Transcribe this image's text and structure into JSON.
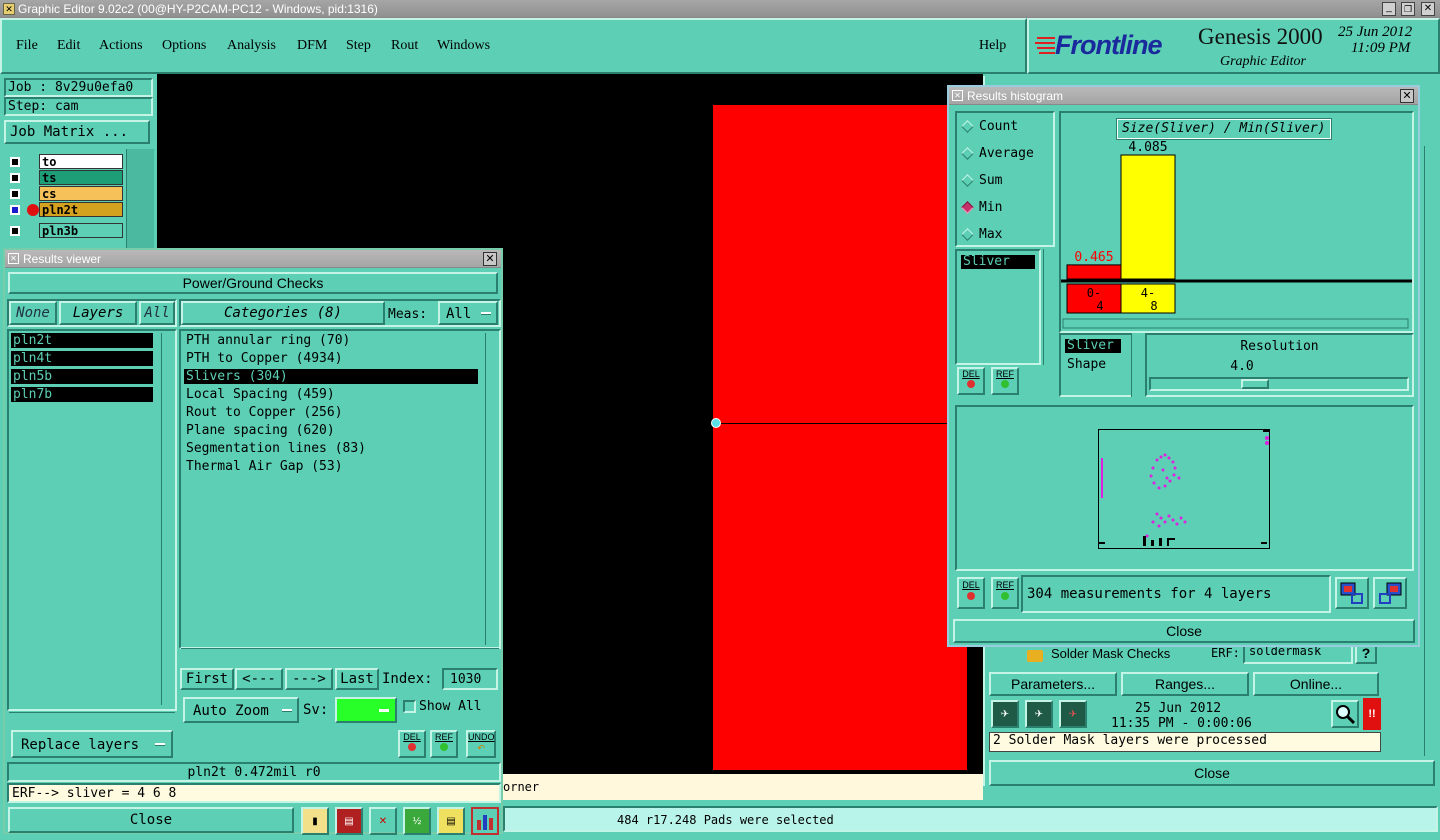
{
  "os_title": "Graphic Editor 9.02c2 (00@HY-P2CAM-PC12 - Windows, pid:1316)",
  "menu": [
    "File",
    "Edit",
    "Actions",
    "Options",
    "Analysis",
    "DFM",
    "Step",
    "Rout",
    "Windows"
  ],
  "help": "Help",
  "brand": {
    "logo": "Frontline",
    "product": "Genesis 2000",
    "subtitle": "Graphic Editor",
    "date": "25 Jun 2012",
    "time": "11:09 PM"
  },
  "job": {
    "job": "Job : 8v29u0efa0",
    "step": "Step: cam",
    "matrix_button": "Job Matrix ..."
  },
  "layers_panel": [
    {
      "name": "to",
      "color": "#ffffff"
    },
    {
      "name": "ts",
      "color": "#1e9e76"
    },
    {
      "name": "cs",
      "color": "#f7c15a"
    },
    {
      "name": "pln2t",
      "color": "#d4a21e"
    },
    {
      "name": "pln3b",
      "color": "#5ccfb4"
    }
  ],
  "results_viewer": {
    "title": "Results viewer",
    "header": "Power/Ground Checks",
    "none": "None",
    "layers": "Layers",
    "all": "All",
    "categories": "Categories (8)",
    "meas_label": "Meas:",
    "meas_value": "All",
    "layer_items": [
      "pln2t",
      "pln4t",
      "pln5b",
      "pln7b"
    ],
    "cat_items": [
      "PTH annular ring (70)",
      "PTH to Copper (4934)",
      "Slivers (304)",
      "Local Spacing (459)",
      "Rout to Copper (256)",
      "Plane spacing (620)",
      "Segmentation lines (83)",
      "Thermal Air Gap (53)"
    ],
    "selected_cat": 2,
    "nav": {
      "first": "First",
      "prev": "<---",
      "next": "--->",
      "last": "Last",
      "index_label": "Index:",
      "index_value": "1030"
    },
    "auto_zoom": "Auto Zoom",
    "sv": "Sv:",
    "show_all": "Show All",
    "replace_layers": "Replace layers",
    "del": "DEL",
    "ref": "REF",
    "undo": "UNDO",
    "status": "pln2t 0.472mil  r0",
    "erf": "ERF--> sliver = 4 6 8",
    "close": "Close"
  },
  "results_histogram": {
    "title": "Results histogram",
    "modes": [
      "Count",
      "Average",
      "Sum",
      "Min",
      "Max"
    ],
    "selected_mode": 3,
    "list_item": "Sliver",
    "chart_title": "Size(Sliver) / Min(Sliver)",
    "res_list": [
      "Sliver",
      "Shape"
    ],
    "resolution_label": "Resolution",
    "resolution_value": "4.0",
    "measurements": "304 measurements for 4 layers",
    "del": "DEL",
    "ref": "REF",
    "close": "Close"
  },
  "chart_data": {
    "type": "bar",
    "categories": [
      "0-4",
      "4-8"
    ],
    "values": [
      0.465,
      4.085
    ],
    "colors": [
      "#ff0000",
      "#ffff00"
    ],
    "title": "Size(Sliver) / Min(Sliver)",
    "ylim": [
      0,
      4.5
    ]
  },
  "drc_panel": {
    "check": "Solder Mask Checks",
    "erf": "ERF:",
    "erf_value": "soldermask",
    "help": "?",
    "parameters": "Parameters...",
    "ranges": "Ranges...",
    "online": "Online...",
    "date": "25 Jun 2012",
    "time": "11:35 PM - 0:00:06",
    "alert": "!!",
    "message": "2 Solder Mask layers were processed",
    "close": "Close"
  },
  "canvas_status": "orner",
  "bottom_status": "484 r17.248 Pads were selected"
}
